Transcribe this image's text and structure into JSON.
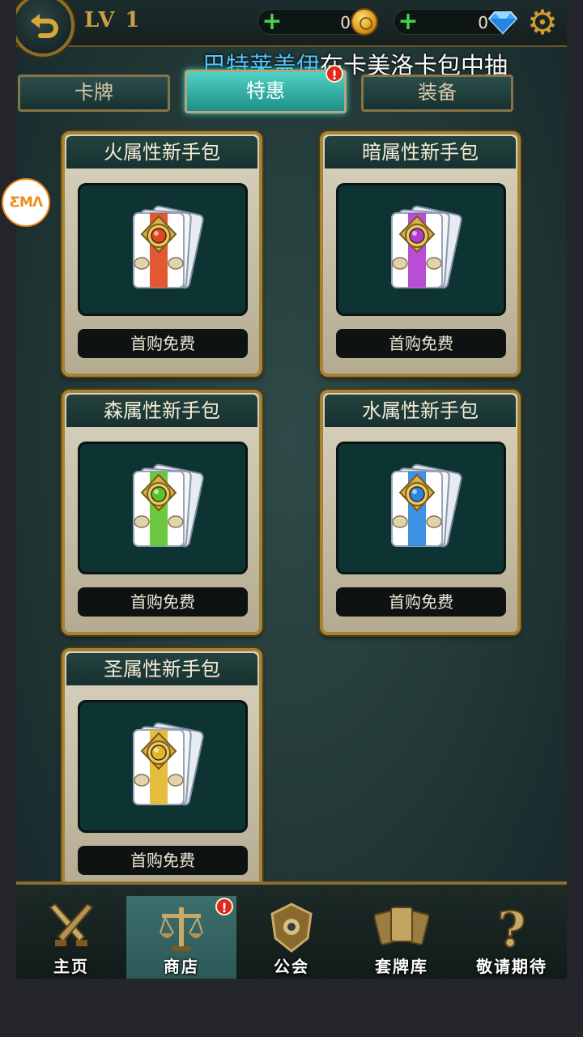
{
  "header": {
    "level": "LV 1",
    "coins": "0",
    "gems": "0",
    "plus_symbol": "+",
    "icons": {
      "back": "back-arrow-icon",
      "coin": "coin-icon",
      "gem": "diamond-icon",
      "settings": "gear-icon"
    }
  },
  "marquee": {
    "name": "巴特莱盖伊",
    "message": "在卡美洛卡包中抽"
  },
  "tabs": [
    {
      "label": "卡牌",
      "active": false
    },
    {
      "label": "特惠",
      "active": true,
      "alert": "!"
    },
    {
      "label": "装备",
      "active": false
    }
  ],
  "packs": [
    {
      "title": "火属性新手包",
      "button": "首购免费",
      "color": "#e0451c"
    },
    {
      "title": "暗属性新手包",
      "button": "首购免费",
      "color": "#b23ad0"
    },
    {
      "title": "森属性新手包",
      "button": "首购免费",
      "color": "#5cc22a"
    },
    {
      "title": "水属性新手包",
      "button": "首购免费",
      "color": "#2a86e0"
    },
    {
      "title": "圣属性新手包",
      "button": "首购免费",
      "color": "#e2b62a"
    }
  ],
  "overlay_badge": "ƸMΛ",
  "nav": {
    "items": [
      {
        "label": "主页",
        "icon": "crossed-swords-icon",
        "active": false
      },
      {
        "label": "商店",
        "icon": "scales-icon",
        "active": true
      },
      {
        "label": "公会",
        "icon": "guild-crest-icon",
        "active": false
      },
      {
        "label": "套牌库",
        "icon": "card-deck-icon",
        "active": false
      },
      {
        "label": "敬请期待",
        "icon": "question-mark-icon",
        "active": false
      }
    ],
    "alert": "!"
  },
  "colors": {
    "accent_gold": "#a48336",
    "tab_active": "#3bd0c4",
    "alert_red": "#e0261d",
    "marquee_name": "#55c4ff"
  }
}
